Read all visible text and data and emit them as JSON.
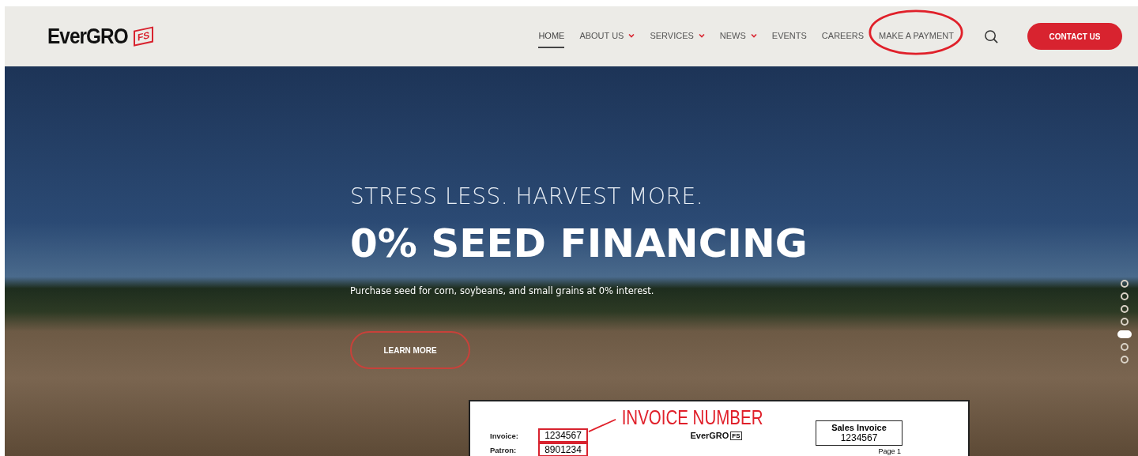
{
  "header": {
    "logo": {
      "text": "EverGRO",
      "badge": "FS"
    },
    "nav": [
      {
        "label": "HOME",
        "selected": true,
        "dropdown": false,
        "annotated": false
      },
      {
        "label": "ABOUT US",
        "selected": false,
        "dropdown": true,
        "annotated": false
      },
      {
        "label": "SERVICES",
        "selected": false,
        "dropdown": true,
        "annotated": false
      },
      {
        "label": "NEWS",
        "selected": false,
        "dropdown": true,
        "annotated": false
      },
      {
        "label": "EVENTS",
        "selected": false,
        "dropdown": false,
        "annotated": false
      },
      {
        "label": "CAREERS",
        "selected": false,
        "dropdown": false,
        "annotated": false
      },
      {
        "label": "MAKE A PAYMENT",
        "selected": false,
        "dropdown": false,
        "annotated": true
      }
    ],
    "contact_button": "CONTACT US"
  },
  "hero": {
    "tagline": "STRESS LESS. HARVEST MORE.",
    "headline": "0% SEED FINANCING",
    "description": "Purchase seed for corn, soybeans, and small grains at 0% interest.",
    "button": "LEARN MORE",
    "slide_dots": [
      {
        "selected": false
      },
      {
        "selected": false
      },
      {
        "selected": false
      },
      {
        "selected": false
      },
      {
        "selected": true
      },
      {
        "selected": false
      },
      {
        "selected": false
      }
    ]
  },
  "invoice_inset": {
    "annotation": "INVOICE NUMBER",
    "fields": [
      {
        "label": "Invoice:",
        "value": "1234567",
        "highlighted": true
      },
      {
        "label": "Patron:",
        "value": "8901234",
        "highlighted": true
      }
    ],
    "logo": {
      "text": "EverGRO",
      "badge": "FS"
    },
    "title": "Sales Invoice",
    "number": "1234567",
    "page": "Page 1"
  }
}
